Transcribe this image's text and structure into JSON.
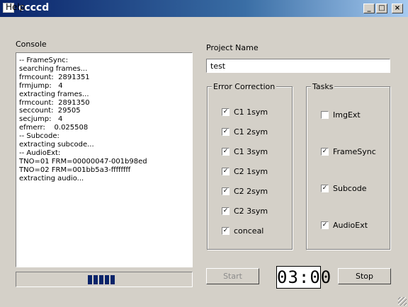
{
  "window": {
    "title": "ccccd"
  },
  "menu": {
    "help": "Help"
  },
  "console": {
    "label": "Console",
    "lines": [
      "-- FrameSync:",
      "searching frames...",
      "frmcount:  2891351",
      "frmjump:   4",
      "extracting frames...",
      "frmcount:  2891350",
      "seccount:  29505",
      "secjump:   4",
      "efmerr:    0.025508",
      "-- Subcode:",
      "extracting subcode...",
      "-- AudioExt:",
      "TNO=01 FRM=00000047-001b98ed",
      "TNO=02 FRM=001bb5a3-ffffffff",
      "extracting audio..."
    ]
  },
  "progress": {
    "value": 0.4
  },
  "project": {
    "label": "Project Name",
    "value": "test"
  },
  "error_correction": {
    "title": "Error Correction",
    "items": [
      {
        "label": "C1 1sym",
        "checked": true
      },
      {
        "label": "C1 2sym",
        "checked": true
      },
      {
        "label": "C1 3sym",
        "checked": true
      },
      {
        "label": "C2 1sym",
        "checked": true
      },
      {
        "label": "C2 2sym",
        "checked": true
      },
      {
        "label": "C2 3sym",
        "checked": true
      },
      {
        "label": "conceal",
        "checked": true
      }
    ]
  },
  "tasks": {
    "title": "Tasks",
    "items": [
      {
        "label": "ImgExt",
        "checked": false
      },
      {
        "label": "FrameSync",
        "checked": true
      },
      {
        "label": "Subcode",
        "checked": true
      },
      {
        "label": "AudioExt",
        "checked": true
      }
    ]
  },
  "buttons": {
    "start": "Start",
    "stop": "Stop"
  },
  "timer": "03:00",
  "caption_buttons": {
    "minimize": "_",
    "maximize": "□",
    "close": "×"
  }
}
